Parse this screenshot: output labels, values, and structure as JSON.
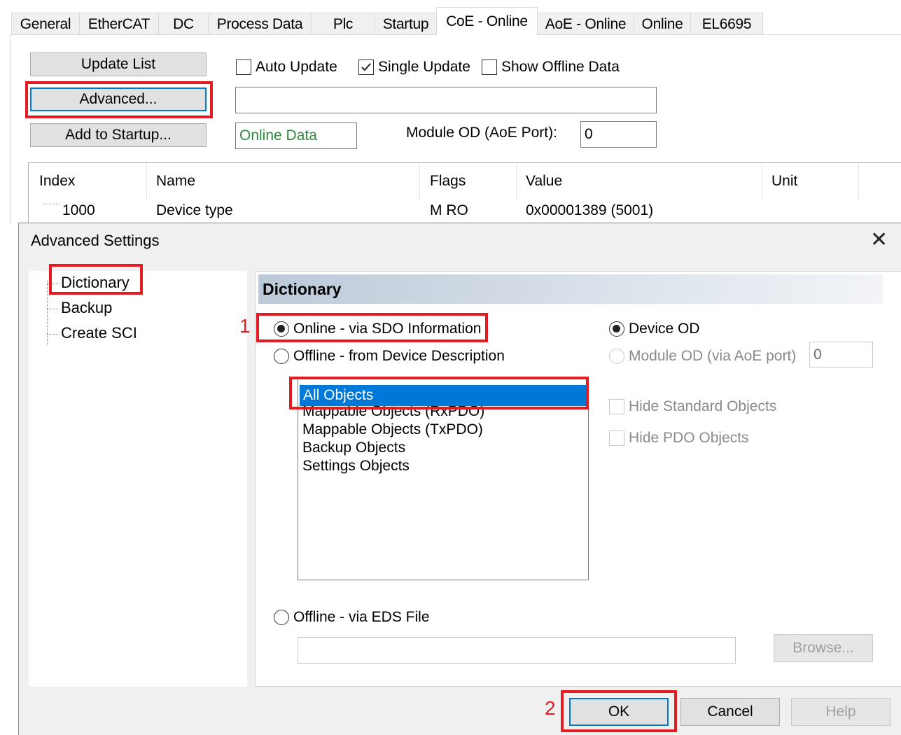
{
  "tabs": [
    "General",
    "EtherCAT",
    "DC",
    "Process Data",
    "Plc",
    "Startup",
    "CoE - Online",
    "AoE - Online",
    "Online",
    "EL6695"
  ],
  "coe": {
    "update_list": "Update List",
    "advanced": "Advanced...",
    "add_to_startup": "Add to Startup...",
    "auto_update": "Auto Update",
    "single_update": "Single Update",
    "show_offline": "Show Offline Data",
    "online_data": "Online Data",
    "module_od_label": "Module OD (AoE Port):",
    "module_od_value": "0",
    "columns": {
      "index": "Index",
      "name": "Name",
      "flags": "Flags",
      "value": "Value",
      "unit": "Unit"
    },
    "rows": [
      {
        "index": "1000",
        "name": "Device type",
        "flags": "M RO",
        "value": "0x00001389 (5001)",
        "unit": ""
      }
    ]
  },
  "dialog": {
    "title": "Advanced Settings",
    "tree": [
      "Dictionary",
      "Backup",
      "Create SCI"
    ],
    "pane_title": "Dictionary",
    "online_sdo": "Online - via SDO Information",
    "offline_desc": "Offline - from Device Description",
    "objects": [
      "All Objects",
      "Mappable Objects (RxPDO)",
      "Mappable Objects (TxPDO)",
      "Backup Objects",
      "Settings Objects"
    ],
    "offline_eds": "Offline - via EDS File",
    "browse": "Browse...",
    "device_od": "Device OD",
    "module_od": "Module OD (via AoE port)",
    "module_od_value": "0",
    "hide_standard": "Hide Standard Objects",
    "hide_pdo": "Hide PDO Objects",
    "ok": "OK",
    "cancel": "Cancel",
    "help": "Help"
  },
  "markers": {
    "step1": "1",
    "step2": "2"
  },
  "colors": {
    "highlight": "#e31b23",
    "selection": "#0078d7"
  }
}
